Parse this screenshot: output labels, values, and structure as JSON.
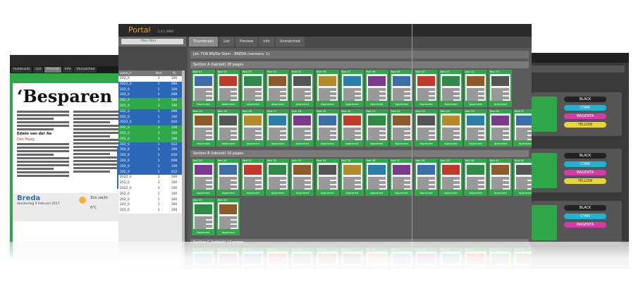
{
  "right_window": {
    "tags": [
      "BLACK",
      "CYAN",
      "MAGENTA",
      "YELLOW"
    ]
  },
  "left_window": {
    "tabs": [
      "humbnails",
      "List",
      "Preview",
      "Info",
      "Unmatched"
    ],
    "headline": "‘Besparen op",
    "author": "Edwin van der Aa",
    "byline": "Den Haag",
    "place": "Breda",
    "date": "donderdag 9 februari 2017",
    "weather": "Zon zacht",
    "temperature": "6°C"
  },
  "app": {
    "title": "Portal",
    "version": "2.4.1 (090)",
    "filter_label": "Plan filter"
  },
  "tabs": [
    "Thumbnails",
    "List",
    "Preview",
    "Info",
    "Unmatched"
  ],
  "list": {
    "headers": [
      "name_ir",
      "Vers",
      "%"
    ],
    "rows": [
      {
        "name": "202_0",
        "ver": "3",
        "pct": "100",
        "color": "white"
      },
      {
        "name": "2022_0",
        "ver": "1",
        "pct": "098",
        "color": "blue"
      },
      {
        "name": "202_0",
        "ver": "1",
        "pct": "100",
        "color": "blue"
      },
      {
        "name": "202_0",
        "ver": "1",
        "pct": "098",
        "color": "blue"
      },
      {
        "name": "202_0",
        "ver": "3",
        "pct": "100",
        "color": "green"
      },
      {
        "name": "202_0",
        "ver": "3",
        "pct": "100",
        "color": "green"
      },
      {
        "name": "202_0",
        "ver": "1",
        "pct": "098",
        "color": "blue"
      },
      {
        "name": "202_0",
        "ver": "1",
        "pct": "100",
        "color": "blue"
      },
      {
        "name": "2022_0",
        "ver": "1",
        "pct": "010",
        "color": "blue"
      },
      {
        "name": "202_0",
        "ver": "3",
        "pct": "100",
        "color": "green"
      },
      {
        "name": "202_0",
        "ver": "3",
        "pct": "100",
        "color": "green"
      },
      {
        "name": "202_0",
        "ver": "3",
        "pct": "100",
        "color": "green"
      },
      {
        "name": "202_0",
        "ver": "1",
        "pct": "012",
        "color": "blue"
      },
      {
        "name": "202_0",
        "ver": "1",
        "pct": "100",
        "color": "blue"
      },
      {
        "name": "202_0",
        "ver": "1",
        "pct": "010",
        "color": "blue"
      },
      {
        "name": "202_0",
        "ver": "1",
        "pct": "008",
        "color": "blue"
      },
      {
        "name": "202_0",
        "ver": "1",
        "pct": "100",
        "color": "blue"
      },
      {
        "name": "202_0",
        "ver": "1",
        "pct": "012",
        "color": "blue"
      },
      {
        "name": "2022_0",
        "ver": "3",
        "pct": "100",
        "color": "white"
      },
      {
        "name": "202_0",
        "ver": "3",
        "pct": "100",
        "color": "white"
      },
      {
        "name": "2022_0",
        "ver": "3",
        "pct": "100",
        "color": "white"
      },
      {
        "name": "202_0",
        "ver": "1",
        "pct": "100",
        "color": "white"
      },
      {
        "name": "202_0",
        "ver": "1",
        "pct": "100",
        "color": "white"
      },
      {
        "name": "202_0",
        "ver": "1",
        "pct": "100",
        "color": "white"
      },
      {
        "name": "202_0",
        "ver": "1",
        "pct": "100",
        "color": "white"
      }
    ]
  },
  "job_title": "Job: FDR BN/De Stem - BREDA (versions: 1)",
  "sections": [
    {
      "title": "Section A (tabloid) 28 pages",
      "rows": [
        [
          "Red 01",
          "Red 02",
          "Red 03",
          "Red 04",
          "Red 05",
          "Red 06",
          "Red 07",
          "Red 08",
          "Red 09",
          "Red 10",
          "Red 11",
          "Adv 12",
          "Red 13"
        ],
        [
          "Red 14",
          "Red 15",
          "Red 16",
          "Red 17",
          "Adv 18",
          "Red 19",
          "Red 20",
          "Red 21",
          "Red 22",
          "Red 23",
          "Red 24",
          "Adv 25",
          "Red 26",
          "Red 27"
        ]
      ]
    },
    {
      "title": "Section B (tabloid) 16 pages",
      "rows": [
        [
          "Red 29",
          "Red 30",
          "Red 31",
          "Red 32",
          "Adv 33",
          "Red 34",
          "Red 35",
          "Red 36",
          "Red 37",
          "Red 38",
          "Red 39",
          "Red 40",
          "Red 41",
          "Red 42"
        ],
        [
          "Adv 43",
          "Red 44"
        ]
      ]
    },
    {
      "title": "Section C (tabloid) 12 pages",
      "rows": [
        [
          "Red 45",
          "Red 46",
          "Red 47",
          "Red 48",
          "Red 49",
          "Red 50",
          "Red 51",
          "Red 52",
          "Red 53",
          "Red 54",
          "Red 55",
          "Red 56",
          "Red 57",
          "Red 58"
        ]
      ]
    }
  ],
  "card_status": "Approved",
  "colors": {
    "approved": "#2fa84a",
    "brand": "#e0a030",
    "list_blue": "#2d68b8"
  }
}
